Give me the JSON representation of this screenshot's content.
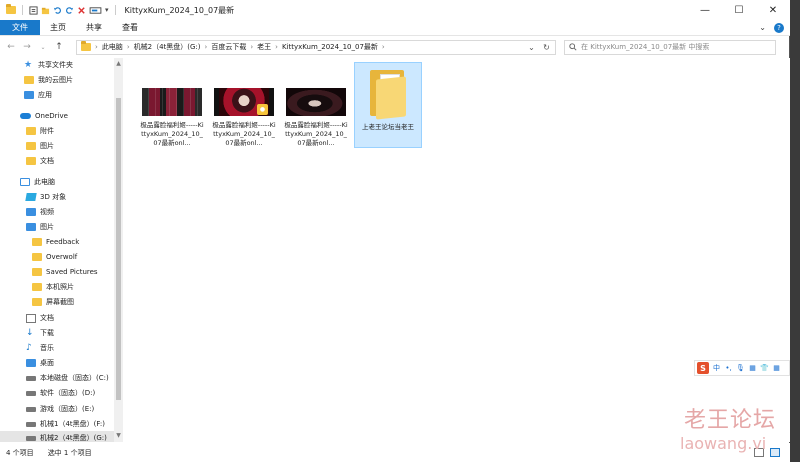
{
  "window": {
    "title": "KittyxKum_2024_10_07最新",
    "minimize": "—",
    "maximize": "☐",
    "close": "✕"
  },
  "ribbon": {
    "tabs": [
      "文件",
      "主页",
      "共享",
      "查看"
    ],
    "collapse": "⌄",
    "help": "?"
  },
  "address": {
    "crumbs": [
      "此电脑",
      "机械2（4t黑盘）(G:)",
      "百度云下载",
      "老王",
      "KittyxKum_2024_10_07最新"
    ],
    "search_placeholder": "在 KittyxKum_2024_10_07最新 中搜索"
  },
  "nav": {
    "items": [
      {
        "label": "共享文件夹",
        "icon": "star-icon"
      },
      {
        "label": "我的云图片",
        "icon": "folder-icon"
      },
      {
        "label": "应用",
        "icon": "apps-icon"
      },
      {
        "label": "OneDrive",
        "icon": "cloud-icon"
      },
      {
        "label": "附件",
        "icon": "folder-icon"
      },
      {
        "label": "图片",
        "icon": "folder-icon"
      },
      {
        "label": "文档",
        "icon": "folder-icon"
      },
      {
        "label": "此电脑",
        "icon": "pc-icon"
      },
      {
        "label": "3D 对象",
        "icon": "cube-icon"
      },
      {
        "label": "视频",
        "icon": "video-icon"
      },
      {
        "label": "图片",
        "icon": "pictures-icon"
      },
      {
        "label": "Feedback",
        "icon": "folder-icon"
      },
      {
        "label": "Overwolf",
        "icon": "folder-icon"
      },
      {
        "label": "Saved Pictures",
        "icon": "folder-icon"
      },
      {
        "label": "本机照片",
        "icon": "folder-icon"
      },
      {
        "label": "屏幕截图",
        "icon": "folder-icon"
      },
      {
        "label": "文档",
        "icon": "document-icon"
      },
      {
        "label": "下载",
        "icon": "download-icon"
      },
      {
        "label": "音乐",
        "icon": "music-icon"
      },
      {
        "label": "桌面",
        "icon": "desktop-icon"
      },
      {
        "label": "本地磁盘（固态）(C:)",
        "icon": "drive-icon"
      },
      {
        "label": "软件（固态）(D:)",
        "icon": "drive-icon"
      },
      {
        "label": "游戏（固态）(E:)",
        "icon": "drive-icon"
      },
      {
        "label": "机械1（4t黑盘）(F:)",
        "icon": "drive-icon"
      },
      {
        "label": "机械2（4t黑盘）(G:)",
        "icon": "drive-icon"
      }
    ]
  },
  "files": [
    {
      "name": "极品露脸福利姬-----KittyxKum_2024_10_07最新onl...",
      "kind": "video"
    },
    {
      "name": "极品露脸福利姬-----KittyxKum_2024_10_07最新onl...",
      "kind": "video-badge"
    },
    {
      "name": "极品露脸福利姬-----KittyxKum_2024_10_07最新onl...",
      "kind": "video"
    },
    {
      "name": "上老王论坛当老王",
      "kind": "folder"
    }
  ],
  "status": {
    "count": "4 个项目",
    "selected": "选中 1 个项目"
  },
  "ime": {
    "logo": "S",
    "items": [
      "中",
      "•,",
      "🎙",
      "▦",
      "👕",
      "▦"
    ]
  },
  "watermark": {
    "cn": "老王论坛",
    "en": "laowang.vi"
  }
}
